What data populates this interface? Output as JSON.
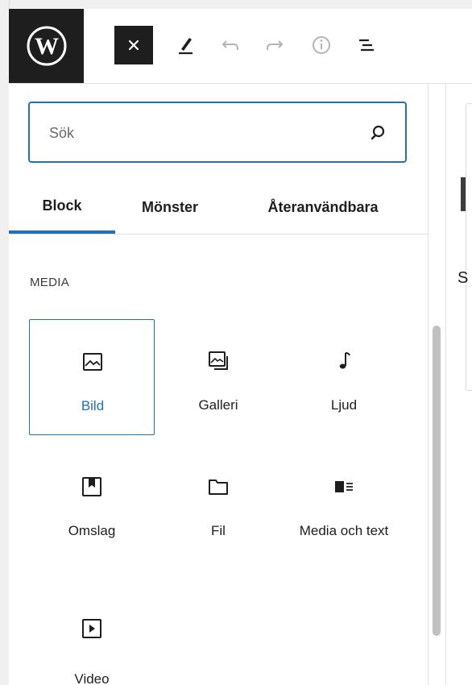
{
  "header": {
    "logo_name": "wordpress-logo",
    "tools": [
      {
        "name": "close-icon"
      },
      {
        "name": "pencil-icon"
      },
      {
        "name": "undo-icon"
      },
      {
        "name": "redo-icon"
      },
      {
        "name": "info-icon"
      },
      {
        "name": "list-view-icon"
      }
    ]
  },
  "search": {
    "placeholder": "Sök",
    "value": ""
  },
  "tabs": [
    {
      "label": "Block",
      "active": true
    },
    {
      "label": "Mönster",
      "active": false
    },
    {
      "label": "Återanvändbara",
      "active": false
    }
  ],
  "section": {
    "title": "MEDIA"
  },
  "blocks": [
    {
      "label": "Bild",
      "icon": "image-icon",
      "selected": true
    },
    {
      "label": "Galleri",
      "icon": "gallery-icon",
      "selected": false
    },
    {
      "label": "Ljud",
      "icon": "audio-icon",
      "selected": false
    },
    {
      "label": "Omslag",
      "icon": "cover-icon",
      "selected": false
    },
    {
      "label": "Fil",
      "icon": "file-icon",
      "selected": false
    },
    {
      "label": "Media och text",
      "icon": "media-text-icon",
      "selected": false
    },
    {
      "label": "Video",
      "icon": "video-icon",
      "selected": false
    }
  ],
  "canvas": {
    "partial_text": "S"
  },
  "colors": {
    "accent": "#2271b1",
    "dark": "#1e1e1e"
  }
}
